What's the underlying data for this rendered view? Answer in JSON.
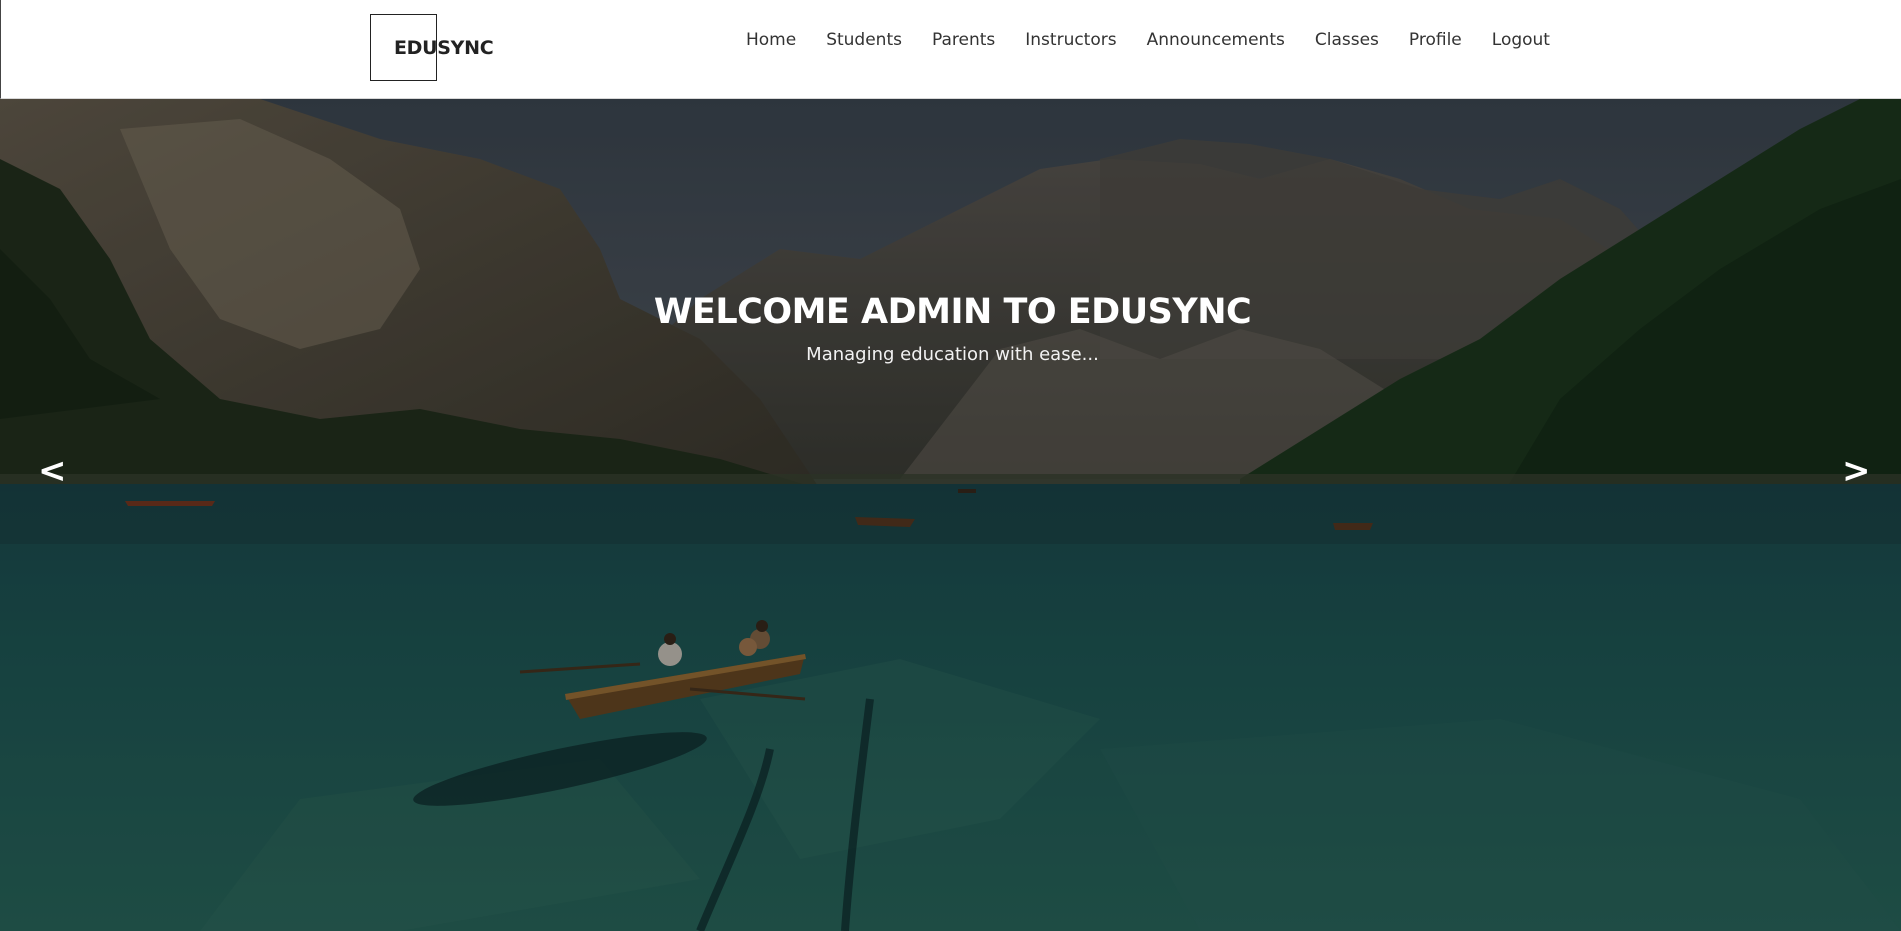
{
  "header": {
    "logo_text": "EDUSYNC",
    "nav": [
      {
        "label": "Home"
      },
      {
        "label": "Students"
      },
      {
        "label": "Parents"
      },
      {
        "label": "Instructors"
      },
      {
        "label": "Announcements"
      },
      {
        "label": "Classes"
      },
      {
        "label": "Profile"
      },
      {
        "label": "Logout"
      }
    ]
  },
  "hero": {
    "title": "WELCOME ADMIN TO EDUSYNC",
    "subtitle": "Managing education with ease...",
    "prev_arrow": "<",
    "next_arrow": ">"
  },
  "colors": {
    "nav_text": "#333333",
    "header_bg": "#ffffff",
    "hero_text": "#ffffff",
    "lake": "#1f5a58"
  }
}
